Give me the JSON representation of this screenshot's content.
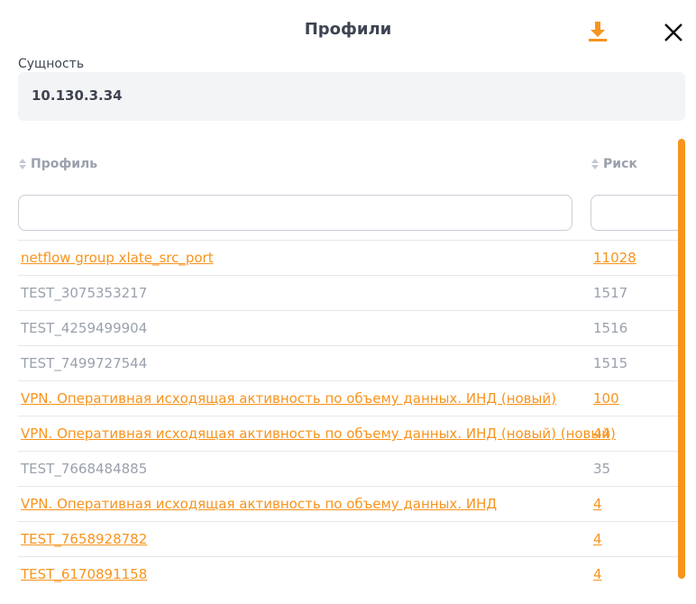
{
  "dialog": {
    "title": "Профили",
    "entity_label": "Сущность",
    "entity_value": "10.130.3.34"
  },
  "colors": {
    "accent": "#f7941d",
    "muted_text": "#9aa1ad",
    "text": "#3d4451"
  },
  "icons": {
    "download": "download-icon",
    "close": "close-icon",
    "sort": "sort-icon"
  },
  "table": {
    "columns": [
      "Профиль",
      "Риск"
    ],
    "filters": {
      "profile": "",
      "risk": ""
    },
    "rows": [
      {
        "name": "netflow group xlate_src_port",
        "risk": "11028",
        "link": true
      },
      {
        "name": "TEST_3075353217",
        "risk": "1517",
        "link": false
      },
      {
        "name": "TEST_4259499904",
        "risk": "1516",
        "link": false
      },
      {
        "name": "TEST_7499727544",
        "risk": "1515",
        "link": false
      },
      {
        "name": "VPN. Оперативная исходящая активность по объему данных. ИНД (новый)",
        "risk": "100",
        "link": true
      },
      {
        "name": "VPN. Оперативная исходящая активность по объему данных. ИНД (новый) (новый)",
        "risk": "44",
        "link": true
      },
      {
        "name": "TEST_7668484885",
        "risk": "35",
        "link": false
      },
      {
        "name": "VPN. Оперативная исходящая активность по объему данных. ИНД",
        "risk": "4",
        "link": true
      },
      {
        "name": "TEST_7658928782",
        "risk": "4",
        "link": true
      },
      {
        "name": "TEST_6170891158",
        "risk": "4",
        "link": true
      }
    ]
  }
}
